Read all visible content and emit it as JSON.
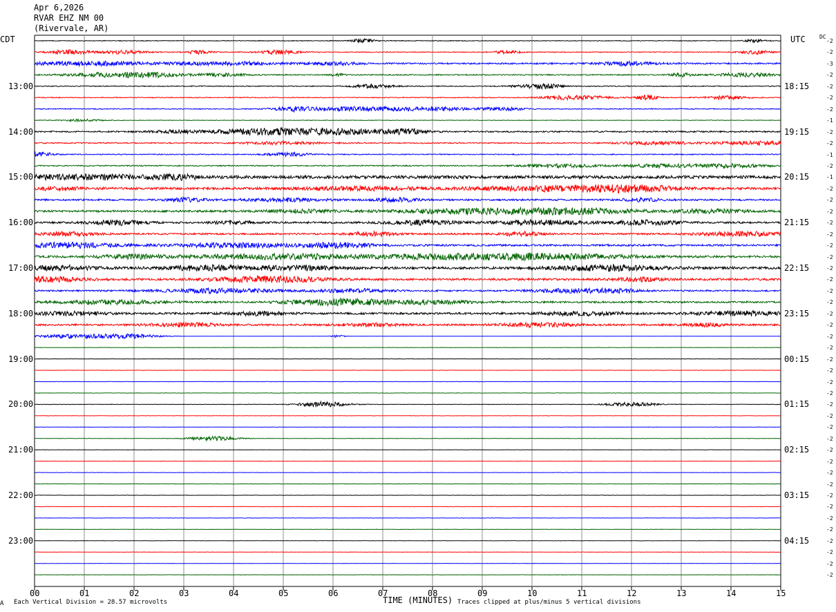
{
  "header": {
    "date": "Apr 6,2026",
    "station": "RVAR EHZ NM 00",
    "location": "(Rivervale, AR)"
  },
  "left_tz": "CDT",
  "right_tz": "UTC",
  "dc_label": "DC",
  "footer": {
    "corner_mark": "A",
    "division_note": "Each Vertical Division =   28.57 microvolts",
    "clip_note": "Traces clipped at plus/minus 5 vertical divisions"
  },
  "chart_data": {
    "type": "line",
    "title": "",
    "xlabel": "TIME (MINUTES)",
    "xlim": [
      0,
      15
    ],
    "x_ticks": [
      "00",
      "01",
      "02",
      "03",
      "04",
      "05",
      "06",
      "07",
      "08",
      "09",
      "10",
      "11",
      "12",
      "13",
      "14",
      "15"
    ],
    "trace_colors": [
      "#000000",
      "#ff0000",
      "#0000ff",
      "#006400"
    ],
    "left_hour_labels": [
      {
        "trace": 4,
        "label": "13:00"
      },
      {
        "trace": 8,
        "label": "14:00"
      },
      {
        "trace": 12,
        "label": "15:00"
      },
      {
        "trace": 16,
        "label": "16:00"
      },
      {
        "trace": 20,
        "label": "17:00"
      },
      {
        "trace": 24,
        "label": "18:00"
      },
      {
        "trace": 28,
        "label": "19:00"
      },
      {
        "trace": 32,
        "label": "20:00"
      },
      {
        "trace": 36,
        "label": "21:00"
      },
      {
        "trace": 40,
        "label": "22:00"
      },
      {
        "trace": 44,
        "label": "23:00"
      }
    ],
    "right_hour_labels": [
      {
        "trace": 4,
        "label": "18:15"
      },
      {
        "trace": 8,
        "label": "19:15"
      },
      {
        "trace": 12,
        "label": "20:15"
      },
      {
        "trace": 16,
        "label": "21:15"
      },
      {
        "trace": 20,
        "label": "22:15"
      },
      {
        "trace": 24,
        "label": "23:15"
      },
      {
        "trace": 28,
        "label": "00:15"
      },
      {
        "trace": 32,
        "label": "01:15"
      },
      {
        "trace": 36,
        "label": "02:15"
      },
      {
        "trace": 40,
        "label": "03:15"
      },
      {
        "trace": 44,
        "label": "04:15"
      }
    ],
    "dc_offsets": [
      "-2",
      "-2",
      "-3",
      "-2",
      "-2",
      "-2",
      "-2",
      "-1",
      "-2",
      "-2",
      "-1",
      "-2",
      "-1",
      "-2",
      "-2",
      "-2",
      "-2",
      "-2",
      "-2",
      "-2",
      "-2",
      "-2",
      "-2",
      "-2",
      "-2",
      "-2",
      "-2",
      "-2",
      "-2",
      "-2",
      "-2",
      "-2",
      "-2",
      "-2",
      "-2",
      "-2",
      "-2",
      "-2",
      "-2",
      "-2",
      "-2",
      "-2",
      "-2",
      "-2",
      "-2",
      "-2",
      "-2",
      "-2"
    ],
    "trace_activity": [
      {
        "base": 0.5,
        "bursts": [
          [
            6.6,
            3,
            0.15
          ],
          [
            14.5,
            2,
            0.15
          ]
        ]
      },
      {
        "base": 0.6,
        "bursts": [
          [
            0.7,
            3,
            0.3
          ],
          [
            1.8,
            2.5,
            0.3
          ],
          [
            3.3,
            2.5,
            0.2
          ],
          [
            4.9,
            3,
            0.3
          ],
          [
            9.5,
            2,
            0.2
          ],
          [
            14.5,
            3,
            0.2
          ]
        ]
      },
      {
        "base": 1.1,
        "bursts": [
          [
            0.5,
            2,
            0.6
          ],
          [
            1.5,
            2,
            0.5
          ],
          [
            3.0,
            1.5,
            0.5
          ],
          [
            4.2,
            2,
            0.5
          ],
          [
            6.0,
            2,
            0.4
          ],
          [
            11.9,
            2.5,
            0.4
          ]
        ]
      },
      {
        "base": 0.8,
        "bursts": [
          [
            1.5,
            3,
            0.6
          ],
          [
            2.5,
            2.5,
            0.5
          ],
          [
            3.8,
            2,
            0.3
          ],
          [
            6.1,
            2,
            0.1
          ],
          [
            13.0,
            2.5,
            0.15
          ],
          [
            14.3,
            2.5,
            0.4
          ]
        ]
      },
      {
        "base": 0.6,
        "bursts": [
          [
            6.8,
            2.5,
            0.3
          ],
          [
            10.0,
            2.5,
            0.3
          ],
          [
            10.4,
            2,
            0.2
          ]
        ]
      },
      {
        "base": 0.6,
        "bursts": [
          [
            10.6,
            2.5,
            0.3
          ],
          [
            11.2,
            2,
            0.3
          ],
          [
            12.3,
            4,
            0.15
          ],
          [
            13.9,
            2.5,
            0.3
          ]
        ]
      },
      {
        "base": 0.6,
        "bursts": [
          [
            5.2,
            3,
            0.3
          ],
          [
            6.3,
            2.5,
            0.6
          ],
          [
            7.5,
            2,
            0.6
          ],
          [
            8.3,
            1.8,
            0.3
          ],
          [
            9.4,
            2.5,
            0.3
          ]
        ]
      },
      {
        "base": 0.4,
        "bursts": [
          [
            1.0,
            1.5,
            0.3
          ]
        ]
      },
      {
        "base": 1.0,
        "bursts": [
          [
            2.8,
            2,
            0.3
          ],
          [
            4.5,
            3,
            0.8
          ],
          [
            5.5,
            2.5,
            0.8
          ],
          [
            7.5,
            3,
            0.3
          ],
          [
            6.5,
            2.5,
            0.6
          ]
        ]
      },
      {
        "base": 0.8,
        "bursts": [
          [
            5.0,
            2,
            0.5
          ],
          [
            12.5,
            2,
            0.5
          ],
          [
            14.5,
            2.5,
            0.6
          ]
        ]
      },
      {
        "base": 0.7,
        "bursts": [
          [
            0.1,
            3,
            0.2
          ],
          [
            5.1,
            2.5,
            0.3
          ]
        ]
      },
      {
        "base": 0.8,
        "bursts": [
          [
            10.6,
            2.5,
            0.5
          ],
          [
            12.6,
            2.5,
            0.5
          ],
          [
            14.0,
            2.5,
            0.5
          ]
        ]
      },
      {
        "base": 2.2,
        "bursts": [
          [
            0.0,
            2,
            0.5
          ],
          [
            1.3,
            3,
            0.5
          ],
          [
            2.8,
            3,
            0.4
          ]
        ]
      },
      {
        "base": 1.6,
        "bursts": [
          [
            0.2,
            2,
            0.6
          ],
          [
            6.5,
            2.5,
            0.8
          ],
          [
            10.5,
            3.5,
            1.2
          ],
          [
            12.0,
            3.5,
            0.6
          ]
        ]
      },
      {
        "base": 1.2,
        "bursts": [
          [
            3.1,
            2.5,
            0.3
          ],
          [
            5.0,
            2,
            0.6
          ],
          [
            7.3,
            2.5,
            0.3
          ],
          [
            12.2,
            2,
            0.3
          ]
        ]
      },
      {
        "base": 1.4,
        "bursts": [
          [
            5.3,
            2,
            0.5
          ],
          [
            9.0,
            3.5,
            1.2
          ],
          [
            11.0,
            3,
            0.8
          ],
          [
            13.5,
            2.5,
            0.6
          ]
        ]
      },
      {
        "base": 1.3,
        "bursts": [
          [
            1.7,
            3,
            0.4
          ],
          [
            4.0,
            2,
            0.3
          ],
          [
            7.8,
            3,
            0.5
          ],
          [
            10.2,
            3.5,
            0.6
          ],
          [
            12.3,
            3,
            0.5
          ]
        ]
      },
      {
        "base": 1.2,
        "bursts": [
          [
            0.7,
            2.5,
            0.4
          ],
          [
            6.8,
            3,
            0.3
          ],
          [
            9.8,
            3,
            0.3
          ],
          [
            14.2,
            3,
            0.6
          ]
        ]
      },
      {
        "base": 1.3,
        "bursts": [
          [
            0.6,
            3.5,
            0.8
          ],
          [
            4.0,
            3,
            0.8
          ],
          [
            6.1,
            3.5,
            0.5
          ]
        ]
      },
      {
        "base": 1.5,
        "bursts": [
          [
            2.0,
            2.5,
            0.5
          ],
          [
            5.0,
            3.5,
            1.2
          ],
          [
            8.5,
            3.5,
            1.0
          ],
          [
            10.5,
            3.5,
            1.0
          ]
        ]
      },
      {
        "base": 1.7,
        "bursts": [
          [
            0.5,
            3,
            0.5
          ],
          [
            3.4,
            3,
            0.6
          ],
          [
            5.2,
            3,
            0.6
          ],
          [
            11.5,
            3.5,
            0.8
          ]
        ]
      },
      {
        "base": 1.5,
        "bursts": [
          [
            0.2,
            3.5,
            0.5
          ],
          [
            4.3,
            3,
            0.6
          ],
          [
            5.2,
            2.5,
            0.5
          ],
          [
            12.2,
            2.5,
            0.3
          ]
        ]
      },
      {
        "base": 1.1,
        "bursts": [
          [
            3.7,
            3,
            0.8
          ],
          [
            6.4,
            2.5,
            0.5
          ],
          [
            10.7,
            2.5,
            0.5
          ],
          [
            11.7,
            2.5,
            0.4
          ]
        ]
      },
      {
        "base": 1.3,
        "bursts": [
          [
            1.6,
            2.5,
            0.8
          ],
          [
            5.7,
            3,
            0.5
          ],
          [
            6.6,
            3,
            0.5
          ],
          [
            8.0,
            2.5,
            0.6
          ]
        ]
      },
      {
        "base": 1.4,
        "bursts": [
          [
            0.7,
            2.5,
            0.5
          ],
          [
            4.5,
            2.5,
            0.4
          ],
          [
            11.0,
            2.5,
            0.6
          ],
          [
            14.2,
            3,
            0.6
          ]
        ]
      },
      {
        "base": 1.3,
        "bursts": [
          [
            3.0,
            2.5,
            0.5
          ],
          [
            6.7,
            2,
            0.4
          ],
          [
            10.2,
            3,
            0.5
          ],
          [
            13.5,
            2,
            0.3
          ]
        ]
      },
      {
        "base": 0.3,
        "bursts": [
          [
            0.8,
            3,
            0.5
          ],
          [
            1.9,
            3,
            0.4
          ],
          [
            6.1,
            2,
            0.1
          ]
        ],
        "active_until": 3.0
      },
      {
        "base": 0.25,
        "bursts": []
      },
      {
        "base": 0.25,
        "bursts": []
      },
      {
        "base": 0.25,
        "bursts": []
      },
      {
        "base": 0.25,
        "bursts": []
      },
      {
        "base": 0.25,
        "bursts": []
      },
      {
        "base": 0.3,
        "bursts": [
          [
            5.8,
            4,
            0.35
          ],
          [
            12.0,
            3,
            0.35
          ]
        ]
      },
      {
        "base": 0.25,
        "bursts": []
      },
      {
        "base": 0.25,
        "bursts": []
      },
      {
        "base": 0.3,
        "bursts": [
          [
            3.6,
            3,
            0.35
          ]
        ]
      },
      {
        "base": 0.25,
        "bursts": []
      },
      {
        "base": 0.25,
        "bursts": []
      },
      {
        "base": 0.25,
        "bursts": []
      },
      {
        "base": 0.25,
        "bursts": []
      },
      {
        "base": 0.25,
        "bursts": []
      },
      {
        "base": 0.25,
        "bursts": []
      },
      {
        "base": 0.25,
        "bursts": []
      },
      {
        "base": 0.25,
        "bursts": []
      },
      {
        "base": 0.25,
        "bursts": []
      },
      {
        "base": 0.25,
        "bursts": []
      },
      {
        "base": 0.25,
        "bursts": []
      },
      {
        "base": 0.25,
        "bursts": []
      }
    ]
  }
}
